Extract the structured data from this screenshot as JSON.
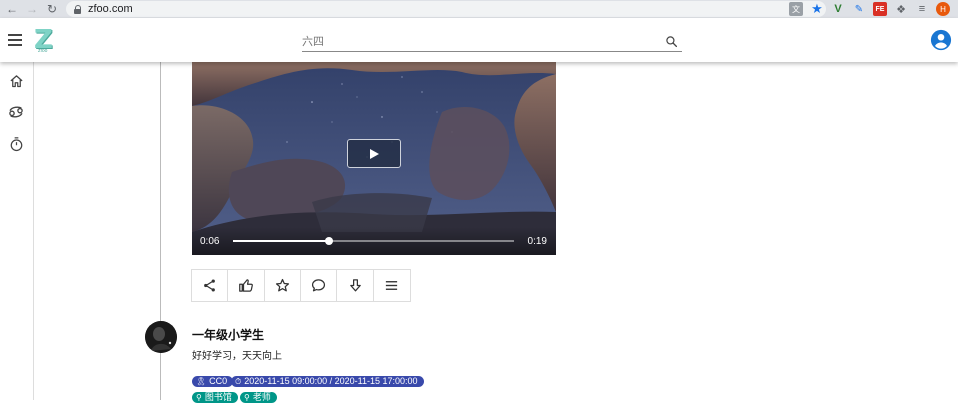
{
  "browser": {
    "url": "zfoo.com",
    "profile_initial": "H"
  },
  "header": {
    "logo_text": "Z",
    "logo_sub": "zfoo",
    "search_placeholder": "六四"
  },
  "video": {
    "current_time": "0:06",
    "duration": "0:19",
    "progress": 0.34
  },
  "actions": [
    "share-icon",
    "thumb-up-icon",
    "star-icon",
    "comment-icon",
    "download-icon",
    "menu-icon"
  ],
  "author": {
    "name": "一年级小学生",
    "motto": "好好学习，天天向上"
  },
  "tags": {
    "license": "CC0",
    "date_range": "2020-11-15 09:00:00 / 2020-11-15 17:00:00",
    "place": "图书馆",
    "role": "老师"
  },
  "colors": {
    "chip_indigo": "#3949ab",
    "chip_teal": "#009688",
    "account": "#1976d2"
  }
}
